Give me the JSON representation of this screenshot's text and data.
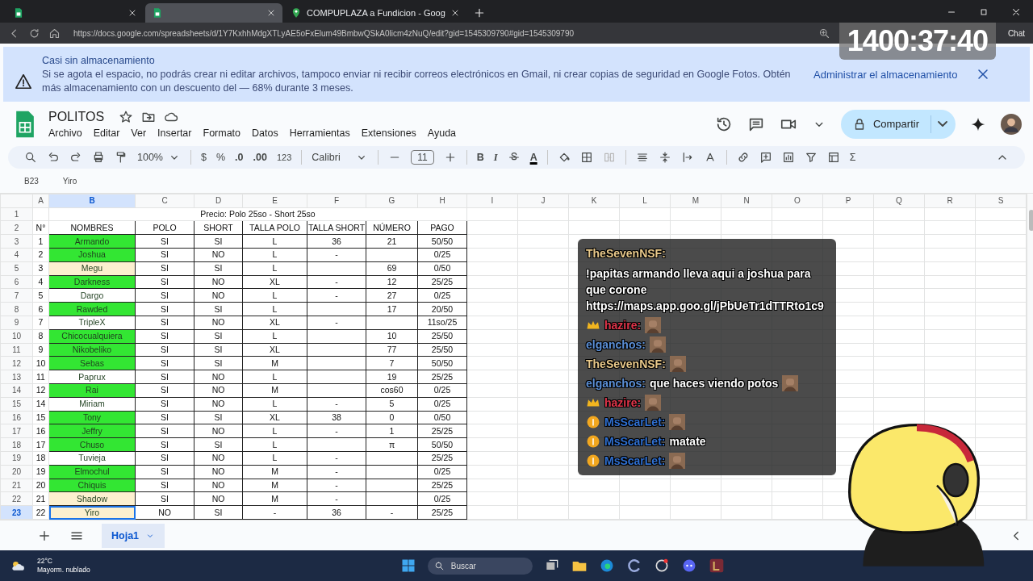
{
  "browser": {
    "tabs": [
      {
        "kind": "sheets",
        "selected": false
      },
      {
        "kind": "sheets",
        "selected": true
      },
      {
        "kind": "maps",
        "title": "COMPUPLAZA a Fundicion - Goog",
        "selected": false
      }
    ],
    "url": "https://docs.google.com/spreadsheets/d/1Y7KxhhMdgXTLyAE5oFxElum49BmbwQSkA0licm4zNuQ/edit?gid=1545309790#gid=1545309790",
    "chat_button": "Chat"
  },
  "banner": {
    "title": "Casi sin almacenamiento",
    "message": "Si se agota el espacio, no podrás crear ni editar archivos, tampoco enviar ni recibir correos electrónicos en Gmail, ni crear copias de seguridad en Google Fotos. Obtén más almacenamiento con un descuento del — 68% durante 3 meses.",
    "action": "Administrar el almacenamiento"
  },
  "doc": {
    "title": "POLITOS",
    "menu": [
      "Archivo",
      "Editar",
      "Ver",
      "Insertar",
      "Formato",
      "Datos",
      "Herramientas",
      "Extensiones",
      "Ayuda"
    ],
    "share": "Compartir"
  },
  "toolbar": {
    "zoom": "100%",
    "currency": "$",
    "percent": "%",
    "decimals_less": ".0",
    "decimals_more": ".00",
    "number_format": "123",
    "font": "Calibri",
    "font_size": "11",
    "bold": "B",
    "italic": "I",
    "text_color": "A",
    "sum": "Σ"
  },
  "formula_bar": {
    "cell": "B23",
    "value": "Yiro"
  },
  "sheet": {
    "columns": [
      {
        "label": "A",
        "selected": false
      },
      {
        "label": "B",
        "selected": true
      },
      {
        "label": "C",
        "selected": false
      },
      {
        "label": "D",
        "selected": false
      },
      {
        "label": "E",
        "selected": false
      },
      {
        "label": "F",
        "selected": false
      },
      {
        "label": "G",
        "selected": false
      },
      {
        "label": "H",
        "selected": false
      },
      {
        "label": "I",
        "selected": false
      },
      {
        "label": "J",
        "selected": false
      },
      {
        "label": "K",
        "selected": false
      },
      {
        "label": "L",
        "selected": false
      },
      {
        "label": "M",
        "selected": false
      },
      {
        "label": "N",
        "selected": false
      },
      {
        "label": "O",
        "selected": false
      },
      {
        "label": "P",
        "selected": false
      },
      {
        "label": "Q",
        "selected": false
      },
      {
        "label": "R",
        "selected": false
      },
      {
        "label": "S",
        "selected": false
      }
    ],
    "title_row": {
      "row": "1",
      "text": "Precio: Polo 25so - Short 25so"
    },
    "header_row": {
      "row": "2",
      "cells": [
        "N°",
        "NOMBRES",
        "POLO",
        "SHORT",
        "TALLA POLO",
        "TALLA SHORT",
        "NÚMERO",
        "PAGO"
      ]
    },
    "rows": [
      {
        "row": "3",
        "n": "1",
        "name": "Armando",
        "color": "#33e633",
        "polo": "SI",
        "short": "SI",
        "talla_polo": "L",
        "talla_short": "36",
        "numero": "21",
        "pago": "50/50",
        "selected": false
      },
      {
        "row": "4",
        "n": "2",
        "name": "Joshua",
        "color": "#33e633",
        "polo": "SI",
        "short": "NO",
        "talla_polo": "L",
        "talla_short": "-",
        "pago": "0/25",
        "selected": false
      },
      {
        "row": "5",
        "n": "3",
        "name": "Megu",
        "color": "#fcf0cf",
        "polo": "SI",
        "short": "SI",
        "talla_polo": "L",
        "numero": "69",
        "pago": "0/50",
        "selected": false
      },
      {
        "row": "6",
        "n": "4",
        "name": "Darkness",
        "color": "#33e633",
        "polo": "SI",
        "short": "NO",
        "talla_polo": "XL",
        "talla_short": "-",
        "numero": "12",
        "pago": "25/25",
        "selected": false
      },
      {
        "row": "7",
        "n": "5",
        "name": "Dargo",
        "color": "#ffffff",
        "polo": "SI",
        "short": "NO",
        "talla_polo": "L",
        "talla_short": "-",
        "numero": "27",
        "pago": "0/25",
        "selected": false
      },
      {
        "row": "8",
        "n": "6",
        "name": "Rawded",
        "color": "#33e633",
        "polo": "SI",
        "short": "SI",
        "talla_polo": "L",
        "numero": "17",
        "pago": "20/50",
        "selected": false
      },
      {
        "row": "9",
        "n": "7",
        "name": "TripleX",
        "color": "#ffffff",
        "polo": "SI",
        "short": "NO",
        "talla_polo": "XL",
        "talla_short": "-",
        "pago": "11so/25",
        "selected": false
      },
      {
        "row": "10",
        "n": "8",
        "name": "Chicocualquiera",
        "color": "#33e633",
        "polo": "SI",
        "short": "SI",
        "talla_polo": "L",
        "numero": "10",
        "pago": "25/50",
        "selected": false
      },
      {
        "row": "11",
        "n": "9",
        "name": "Nikobeliko",
        "color": "#33e633",
        "polo": "SI",
        "short": "SI",
        "talla_polo": "XL",
        "numero": "77",
        "pago": "25/50",
        "selected": false
      },
      {
        "row": "12",
        "n": "10",
        "name": "Sebas",
        "color": "#33e633",
        "polo": "SI",
        "short": "SI",
        "talla_polo": "M",
        "numero": "7",
        "pago": "50/50",
        "selected": false
      },
      {
        "row": "13",
        "n": "11",
        "name": "Paprux",
        "color": "#ffffff",
        "polo": "SI",
        "short": "NO",
        "talla_polo": "L",
        "numero": "19",
        "pago": "25/25",
        "selected": false
      },
      {
        "row": "14",
        "n": "12",
        "name": "Rai",
        "color": "#33e633",
        "polo": "SI",
        "short": "NO",
        "talla_polo": "M",
        "numero": "cos60",
        "pago": "0/25",
        "selected": false
      },
      {
        "row": "15",
        "n": "14",
        "name": "Miriam",
        "color": "#ffffff",
        "polo": "SI",
        "short": "NO",
        "talla_polo": "L",
        "talla_short": "-",
        "numero": "5",
        "pago": "0/25",
        "selected": false
      },
      {
        "row": "16",
        "n": "15",
        "name": "Tony",
        "color": "#33e633",
        "polo": "SI",
        "short": "SI",
        "talla_polo": "XL",
        "talla_short": "38",
        "numero": "0",
        "pago": "0/50",
        "selected": false
      },
      {
        "row": "17",
        "n": "16",
        "name": "Jeffry",
        "color": "#33e633",
        "polo": "SI",
        "short": "NO",
        "talla_polo": "L",
        "talla_short": "-",
        "numero": "1",
        "pago": "25/25",
        "selected": false
      },
      {
        "row": "18",
        "n": "17",
        "name": "Chuso",
        "color": "#33e633",
        "polo": "SI",
        "short": "SI",
        "talla_polo": "L",
        "numero": "π",
        "pago": "50/50",
        "selected": false
      },
      {
        "row": "19",
        "n": "18",
        "name": "Tuvieja",
        "color": "#ffffff",
        "polo": "SI",
        "short": "NO",
        "talla_polo": "L",
        "talla_short": "-",
        "pago": "25/25",
        "selected": false
      },
      {
        "row": "20",
        "n": "19",
        "name": "Elmochul",
        "color": "#33e633",
        "polo": "SI",
        "short": "NO",
        "talla_polo": "M",
        "talla_short": "-",
        "pago": "0/25",
        "selected": false
      },
      {
        "row": "21",
        "n": "20",
        "name": "Chiquis",
        "color": "#33e633",
        "polo": "SI",
        "short": "NO",
        "talla_polo": "M",
        "talla_short": "-",
        "pago": "25/25",
        "selected": false
      },
      {
        "row": "22",
        "n": "21",
        "name": "Shadow",
        "color": "#fcf0cf",
        "polo": "SI",
        "short": "NO",
        "talla_polo": "M",
        "talla_short": "-",
        "pago": "0/25",
        "selected": false
      },
      {
        "row": "23",
        "n": "22",
        "name": "Yiro",
        "color": "#fcf0cf",
        "polo": "NO",
        "short": "SI",
        "talla_polo": "-",
        "talla_short": "36",
        "numero": "-",
        "pago": "25/25",
        "selected": true
      }
    ]
  },
  "sheet_tabs": [
    {
      "label": "Hoja1",
      "selected": true
    }
  ],
  "taskbar": {
    "temperature": "22°C",
    "weather": "Mayorm. nublado",
    "search": "Buscar"
  },
  "stream": {
    "timer": "1400:37:40",
    "chat": [
      {
        "kind": "plain",
        "user": "TheSevenNSF:",
        "color": "#e9c98b",
        "text": "!papitas armando lleva aqui a joshua para que corone https://maps.app.goo.gl/jPbUeTr1dTTRto1c9",
        "emote": false
      },
      {
        "kind": "crown",
        "user": "hazire:",
        "color": "#e0354a",
        "emote": true
      },
      {
        "kind": "plain",
        "user": "elganchos:",
        "color": "#5b8fd6",
        "emote": true
      },
      {
        "kind": "plain",
        "user": "TheSevenNSF:",
        "color": "#e9c98b",
        "emote": true
      },
      {
        "kind": "plain",
        "user": "elganchos:",
        "color": "#5b8fd6",
        "text": "que haces viendo potos",
        "emote": true
      },
      {
        "kind": "crown",
        "user": "hazire:",
        "color": "#e0354a",
        "emote": true
      },
      {
        "kind": "info",
        "user": "MsScarLet:",
        "color": "#2f6fd0",
        "emote": true
      },
      {
        "kind": "info",
        "user": "MsScarLet:",
        "color": "#2f6fd0",
        "text": "matate",
        "emote": false
      },
      {
        "kind": "info",
        "user": "MsScarLet:",
        "color": "#2f6fd0",
        "emote": true
      }
    ]
  }
}
